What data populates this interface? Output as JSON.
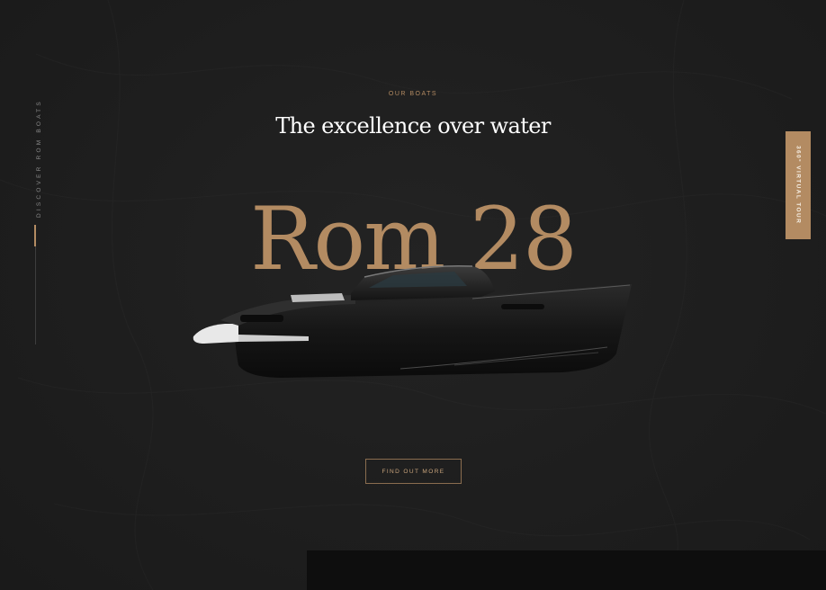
{
  "side": {
    "label": "Discover Rom Boats"
  },
  "tour": {
    "label": "360° Virtual Tour"
  },
  "hero": {
    "eyebrow": "Our Boats",
    "headline": "The excellence over water",
    "model": "Rom 28",
    "cta": "Find out more"
  },
  "colors": {
    "background": "#1d1d1d",
    "accent": "#b38b62",
    "headline": "#ffffff",
    "panel": "#0e0e0e"
  },
  "icons": [
    "boat-image"
  ]
}
